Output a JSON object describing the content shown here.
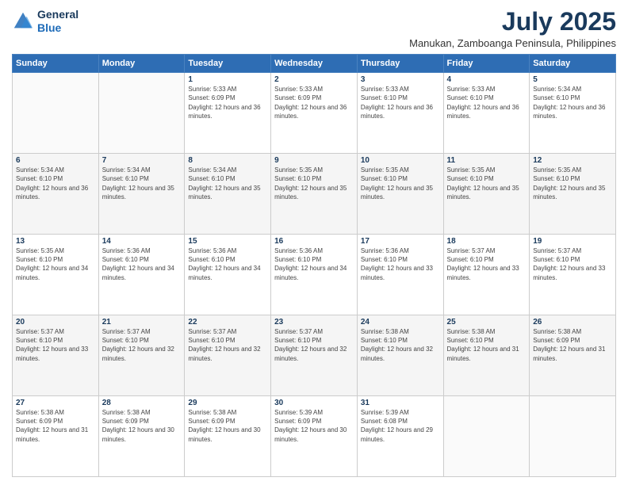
{
  "header": {
    "logo_line1": "General",
    "logo_line2": "Blue",
    "title": "July 2025",
    "subtitle": "Manukan, Zamboanga Peninsula, Philippines"
  },
  "days_of_week": [
    "Sunday",
    "Monday",
    "Tuesday",
    "Wednesday",
    "Thursday",
    "Friday",
    "Saturday"
  ],
  "weeks": [
    [
      {
        "day": "",
        "sunrise": "",
        "sunset": "",
        "daylight": ""
      },
      {
        "day": "",
        "sunrise": "",
        "sunset": "",
        "daylight": ""
      },
      {
        "day": "1",
        "sunrise": "Sunrise: 5:33 AM",
        "sunset": "Sunset: 6:09 PM",
        "daylight": "Daylight: 12 hours and 36 minutes."
      },
      {
        "day": "2",
        "sunrise": "Sunrise: 5:33 AM",
        "sunset": "Sunset: 6:09 PM",
        "daylight": "Daylight: 12 hours and 36 minutes."
      },
      {
        "day": "3",
        "sunrise": "Sunrise: 5:33 AM",
        "sunset": "Sunset: 6:10 PM",
        "daylight": "Daylight: 12 hours and 36 minutes."
      },
      {
        "day": "4",
        "sunrise": "Sunrise: 5:33 AM",
        "sunset": "Sunset: 6:10 PM",
        "daylight": "Daylight: 12 hours and 36 minutes."
      },
      {
        "day": "5",
        "sunrise": "Sunrise: 5:34 AM",
        "sunset": "Sunset: 6:10 PM",
        "daylight": "Daylight: 12 hours and 36 minutes."
      }
    ],
    [
      {
        "day": "6",
        "sunrise": "Sunrise: 5:34 AM",
        "sunset": "Sunset: 6:10 PM",
        "daylight": "Daylight: 12 hours and 36 minutes."
      },
      {
        "day": "7",
        "sunrise": "Sunrise: 5:34 AM",
        "sunset": "Sunset: 6:10 PM",
        "daylight": "Daylight: 12 hours and 35 minutes."
      },
      {
        "day": "8",
        "sunrise": "Sunrise: 5:34 AM",
        "sunset": "Sunset: 6:10 PM",
        "daylight": "Daylight: 12 hours and 35 minutes."
      },
      {
        "day": "9",
        "sunrise": "Sunrise: 5:35 AM",
        "sunset": "Sunset: 6:10 PM",
        "daylight": "Daylight: 12 hours and 35 minutes."
      },
      {
        "day": "10",
        "sunrise": "Sunrise: 5:35 AM",
        "sunset": "Sunset: 6:10 PM",
        "daylight": "Daylight: 12 hours and 35 minutes."
      },
      {
        "day": "11",
        "sunrise": "Sunrise: 5:35 AM",
        "sunset": "Sunset: 6:10 PM",
        "daylight": "Daylight: 12 hours and 35 minutes."
      },
      {
        "day": "12",
        "sunrise": "Sunrise: 5:35 AM",
        "sunset": "Sunset: 6:10 PM",
        "daylight": "Daylight: 12 hours and 35 minutes."
      }
    ],
    [
      {
        "day": "13",
        "sunrise": "Sunrise: 5:35 AM",
        "sunset": "Sunset: 6:10 PM",
        "daylight": "Daylight: 12 hours and 34 minutes."
      },
      {
        "day": "14",
        "sunrise": "Sunrise: 5:36 AM",
        "sunset": "Sunset: 6:10 PM",
        "daylight": "Daylight: 12 hours and 34 minutes."
      },
      {
        "day": "15",
        "sunrise": "Sunrise: 5:36 AM",
        "sunset": "Sunset: 6:10 PM",
        "daylight": "Daylight: 12 hours and 34 minutes."
      },
      {
        "day": "16",
        "sunrise": "Sunrise: 5:36 AM",
        "sunset": "Sunset: 6:10 PM",
        "daylight": "Daylight: 12 hours and 34 minutes."
      },
      {
        "day": "17",
        "sunrise": "Sunrise: 5:36 AM",
        "sunset": "Sunset: 6:10 PM",
        "daylight": "Daylight: 12 hours and 33 minutes."
      },
      {
        "day": "18",
        "sunrise": "Sunrise: 5:37 AM",
        "sunset": "Sunset: 6:10 PM",
        "daylight": "Daylight: 12 hours and 33 minutes."
      },
      {
        "day": "19",
        "sunrise": "Sunrise: 5:37 AM",
        "sunset": "Sunset: 6:10 PM",
        "daylight": "Daylight: 12 hours and 33 minutes."
      }
    ],
    [
      {
        "day": "20",
        "sunrise": "Sunrise: 5:37 AM",
        "sunset": "Sunset: 6:10 PM",
        "daylight": "Daylight: 12 hours and 33 minutes."
      },
      {
        "day": "21",
        "sunrise": "Sunrise: 5:37 AM",
        "sunset": "Sunset: 6:10 PM",
        "daylight": "Daylight: 12 hours and 32 minutes."
      },
      {
        "day": "22",
        "sunrise": "Sunrise: 5:37 AM",
        "sunset": "Sunset: 6:10 PM",
        "daylight": "Daylight: 12 hours and 32 minutes."
      },
      {
        "day": "23",
        "sunrise": "Sunrise: 5:37 AM",
        "sunset": "Sunset: 6:10 PM",
        "daylight": "Daylight: 12 hours and 32 minutes."
      },
      {
        "day": "24",
        "sunrise": "Sunrise: 5:38 AM",
        "sunset": "Sunset: 6:10 PM",
        "daylight": "Daylight: 12 hours and 32 minutes."
      },
      {
        "day": "25",
        "sunrise": "Sunrise: 5:38 AM",
        "sunset": "Sunset: 6:10 PM",
        "daylight": "Daylight: 12 hours and 31 minutes."
      },
      {
        "day": "26",
        "sunrise": "Sunrise: 5:38 AM",
        "sunset": "Sunset: 6:09 PM",
        "daylight": "Daylight: 12 hours and 31 minutes."
      }
    ],
    [
      {
        "day": "27",
        "sunrise": "Sunrise: 5:38 AM",
        "sunset": "Sunset: 6:09 PM",
        "daylight": "Daylight: 12 hours and 31 minutes."
      },
      {
        "day": "28",
        "sunrise": "Sunrise: 5:38 AM",
        "sunset": "Sunset: 6:09 PM",
        "daylight": "Daylight: 12 hours and 30 minutes."
      },
      {
        "day": "29",
        "sunrise": "Sunrise: 5:38 AM",
        "sunset": "Sunset: 6:09 PM",
        "daylight": "Daylight: 12 hours and 30 minutes."
      },
      {
        "day": "30",
        "sunrise": "Sunrise: 5:39 AM",
        "sunset": "Sunset: 6:09 PM",
        "daylight": "Daylight: 12 hours and 30 minutes."
      },
      {
        "day": "31",
        "sunrise": "Sunrise: 5:39 AM",
        "sunset": "Sunset: 6:08 PM",
        "daylight": "Daylight: 12 hours and 29 minutes."
      },
      {
        "day": "",
        "sunrise": "",
        "sunset": "",
        "daylight": ""
      },
      {
        "day": "",
        "sunrise": "",
        "sunset": "",
        "daylight": ""
      }
    ]
  ]
}
